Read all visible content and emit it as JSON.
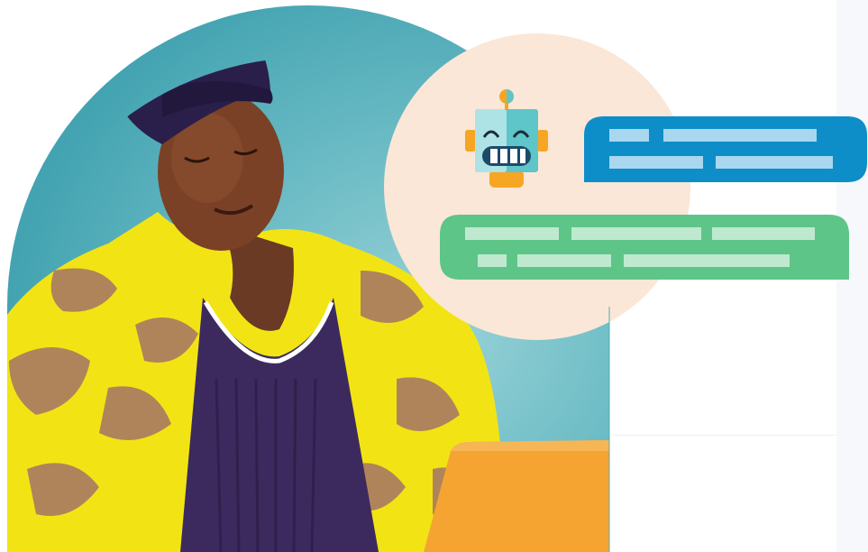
{
  "scene": {
    "description_icon": "robot-icon",
    "colors": {
      "teal_circle": "#52acb9",
      "peach_circle": "#fbe7d7",
      "bot_bubble": "#0e8ec9",
      "user_bubble": "#5ec588",
      "jacket_yellow": "#f2e414",
      "jacket_brown": "#b0845a",
      "sweater_purple": "#3c2a5f",
      "cap": "#2a1f4a",
      "laptop": "#f5a431"
    }
  }
}
